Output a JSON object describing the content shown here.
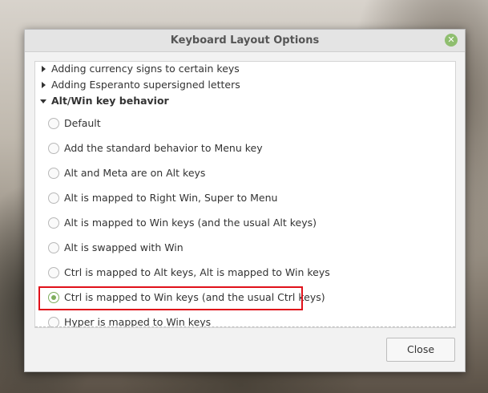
{
  "window": {
    "title": "Keyboard Layout Options"
  },
  "collapsed_groups": [
    {
      "label": "Adding currency signs to certain keys"
    },
    {
      "label": "Adding Esperanto supersigned letters"
    }
  ],
  "expanded_group": {
    "label": "Alt/Win key behavior"
  },
  "options": [
    {
      "label": "Default",
      "checked": false
    },
    {
      "label": "Add the standard behavior to Menu key",
      "checked": false
    },
    {
      "label": "Alt and Meta are on Alt keys",
      "checked": false
    },
    {
      "label": "Alt is mapped to Right Win, Super to Menu",
      "checked": false
    },
    {
      "label": "Alt is mapped to Win keys (and the usual Alt keys)",
      "checked": false
    },
    {
      "label": "Alt is swapped with Win",
      "checked": false
    },
    {
      "label": "Ctrl is mapped to Alt keys, Alt is mapped to Win keys",
      "checked": false
    },
    {
      "label": "Ctrl is mapped to Win keys (and the usual Ctrl keys)",
      "checked": true
    },
    {
      "label": "Hyper is mapped to Win keys",
      "checked": false
    }
  ],
  "footer": {
    "close_label": "Close"
  },
  "colors": {
    "accent": "#7fae5d",
    "highlight_border": "#e0111a"
  }
}
